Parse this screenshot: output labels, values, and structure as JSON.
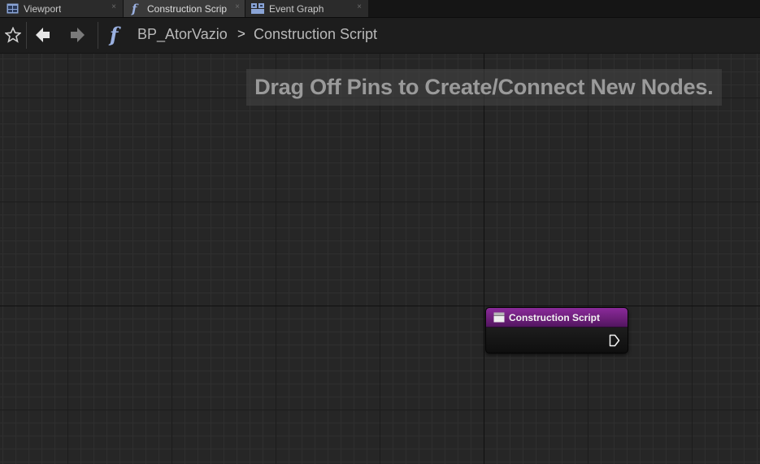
{
  "tabs": [
    {
      "label": "Viewport",
      "icon": "viewport-icon",
      "active": false
    },
    {
      "label": "Construction Scrip",
      "icon": "function-icon",
      "active": true
    },
    {
      "label": "Event Graph",
      "icon": "event-graph-icon",
      "active": false
    }
  ],
  "tab_close_glyph": "×",
  "breadcrumb": {
    "blueprint": "BP_AtorVazio",
    "separator": ">",
    "graph": "Construction Script"
  },
  "graph": {
    "hint": "Drag Off Pins to Create/Connect New Nodes."
  },
  "node": {
    "title": "Construction Script",
    "header_color": "#7a2488"
  },
  "colors": {
    "canvas": "#262626",
    "toolbar": "#1d1d1d",
    "tab_active": "#3a3a3a",
    "function_icon": "#9ab0e0"
  }
}
